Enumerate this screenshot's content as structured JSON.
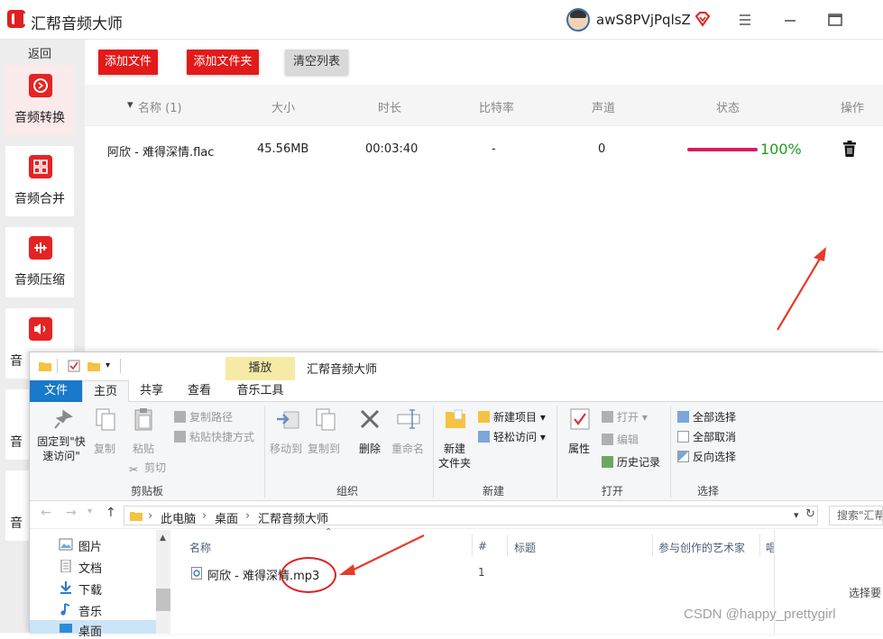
{
  "app": {
    "title": "汇帮音频大师",
    "username": "awS8PVjPqlsZ",
    "back_label": "返回"
  },
  "sidebar": {
    "items": [
      {
        "label": "音频转换",
        "icon": "audio-convert-icon",
        "active": true
      },
      {
        "label": "音频合并",
        "icon": "audio-merge-icon"
      },
      {
        "label": "音频压缩",
        "icon": "audio-compress-icon"
      },
      {
        "label": "音",
        "icon": "audio-volume-icon"
      },
      {
        "label": "音",
        "icon": "audio-icon"
      },
      {
        "label": "音",
        "icon": "audio-icon"
      }
    ]
  },
  "toolbar": {
    "add_file": "添加文件",
    "add_folder": "添加文件夹",
    "clear_list": "清空列表"
  },
  "table": {
    "headers": {
      "name": "名称 (1)",
      "size": "大小",
      "duration": "时长",
      "bitrate": "比特率",
      "channels": "声道",
      "status": "状态",
      "actions": "操作"
    },
    "rows": [
      {
        "name": "阿欣 - 难得深情.flac",
        "size": "45.56MB",
        "duration": "00:03:40",
        "bitrate": "-",
        "channels": "0",
        "progress": 1.0,
        "progress_text": "100%"
      }
    ]
  },
  "explorer": {
    "context_tab_group": "播放",
    "window_title": "汇帮音频大师",
    "tabs": [
      "文件",
      "主页",
      "共享",
      "查看",
      "音乐工具"
    ],
    "ribbon": {
      "clipboard": {
        "pin": "固定到\"快速访问\"",
        "copy": "复制",
        "paste": "粘贴",
        "copy_path": "复制路径",
        "paste_shortcut": "粘贴快捷方式",
        "cut": "剪切",
        "group": "剪贴板"
      },
      "organize": {
        "move_to": "移动到",
        "copy_to": "复制到",
        "delete": "删除",
        "rename": "重命名",
        "group": "组织"
      },
      "new": {
        "new_folder": "新建\n文件夹",
        "new_item": "新建项目",
        "easy_access": "轻松访问",
        "group": "新建"
      },
      "open": {
        "properties": "属性",
        "open": "打开",
        "edit": "编辑",
        "history": "历史记录",
        "group": "打开"
      },
      "select": {
        "select_all": "全部选择",
        "select_none": "全部取消",
        "invert": "反向选择",
        "group": "选择"
      }
    },
    "address": {
      "crumbs": [
        "此电脑",
        "桌面",
        "汇帮音频大师"
      ],
      "search_placeholder": "搜索\"汇帮"
    },
    "nav": [
      "图片",
      "文档",
      "下载",
      "音乐",
      "桌面"
    ],
    "columns": [
      "名称",
      "#",
      "标题",
      "参与创作的艺术家",
      "唱"
    ],
    "files": [
      {
        "name": "阿欣 - 难得深情.mp3",
        "number": "1"
      }
    ],
    "right_pane_text": "选择要"
  },
  "watermark": "CSDN @happy_prettygirl",
  "colors": {
    "accent_red": "#e21a1a",
    "progress": "#d81b60",
    "success_green": "#1ca01c",
    "explorer_blue": "#1979ca"
  }
}
